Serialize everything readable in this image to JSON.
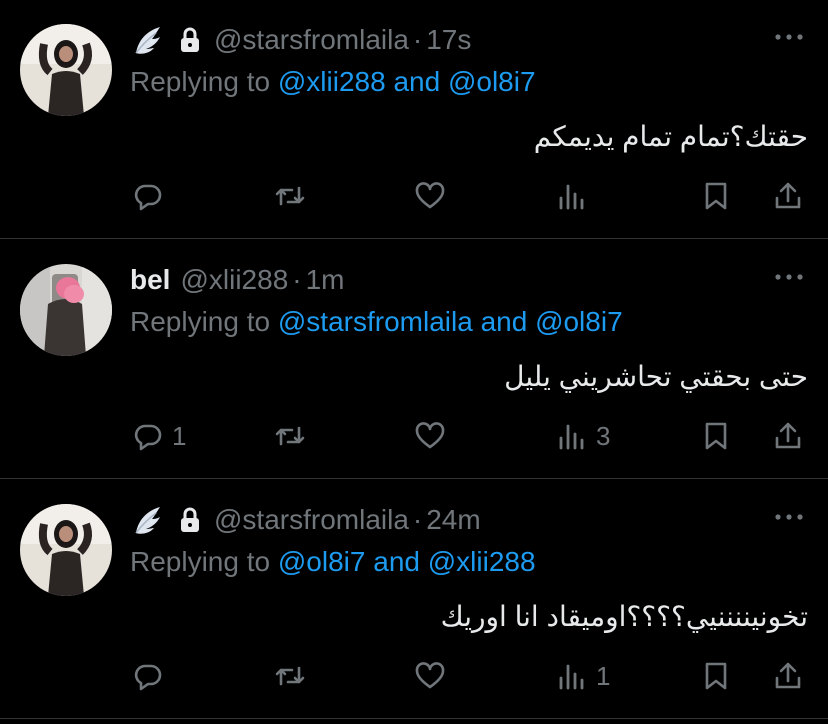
{
  "tweets": [
    {
      "display_name": "",
      "handle": "@starsfromlaila",
      "time": "17s",
      "replying_prefix": "Replying to",
      "reply_to_1": "@xlii288",
      "reply_and": "and",
      "reply_to_2": "@ol8i7",
      "text": "حقتك؟تمام تمام يديمكم",
      "reply_count": "",
      "views_count": "",
      "has_wing": true,
      "has_lock": true
    },
    {
      "display_name": "bel",
      "handle": "@xlii288",
      "time": "1m",
      "replying_prefix": "Replying to",
      "reply_to_1": "@starsfromlaila",
      "reply_and": "and",
      "reply_to_2": "@ol8i7",
      "text": "حتى بحقتي تحاشريني يليل",
      "reply_count": "1",
      "views_count": "3",
      "has_wing": false,
      "has_lock": false
    },
    {
      "display_name": "",
      "handle": "@starsfromlaila",
      "time": "24m",
      "replying_prefix": "Replying to",
      "reply_to_1": "@ol8i7",
      "reply_and": "and",
      "reply_to_2": "@xlii288",
      "text": "تخونيننننيي؟؟؟؟اوميقاد انا اوريك",
      "reply_count": "",
      "views_count": "1",
      "has_wing": true,
      "has_lock": true
    }
  ],
  "separator": "·",
  "colors": {
    "background": "#000000",
    "text": "#e7e9ea",
    "muted": "#71767b",
    "link": "#1d9bf0",
    "divider": "#2f3336"
  },
  "icons": {
    "header": [
      "wing-icon",
      "lock-icon",
      "more-icon"
    ],
    "actions": [
      "reply-icon",
      "retweet-icon",
      "like-icon",
      "views-icon",
      "bookmark-icon",
      "share-icon"
    ]
  }
}
